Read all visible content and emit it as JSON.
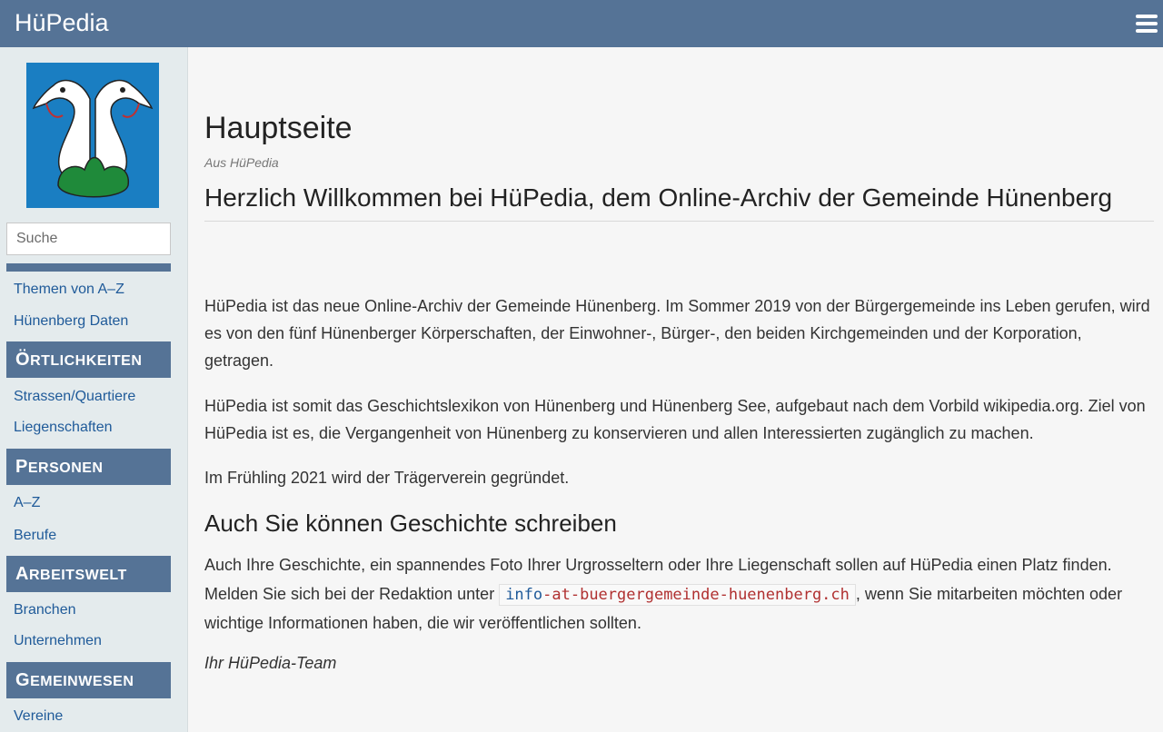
{
  "header": {
    "site_title": "HüPedia"
  },
  "sidebar": {
    "search_placeholder": "Suche",
    "links_top": [
      "Themen von A–Z",
      "Hünenberg Daten"
    ],
    "sections": [
      {
        "cap": "Ö",
        "rest": "RTLICHKEITEN",
        "items": [
          "Strassen/Quartiere",
          "Liegenschaften"
        ]
      },
      {
        "cap": "P",
        "rest": "ERSONEN",
        "items": [
          "A–Z",
          "Berufe"
        ]
      },
      {
        "cap": "A",
        "rest": "RBEITSWELT",
        "items": [
          "Branchen",
          "Unternehmen"
        ]
      },
      {
        "cap": "G",
        "rest": "EMEINWESEN",
        "items": [
          "Vereine"
        ]
      }
    ]
  },
  "main": {
    "title": "Hauptseite",
    "subtitle": "Aus HüPedia",
    "welcome_heading": "Herzlich Willkommen bei HüPedia, dem Online-Archiv der Gemeinde Hünenberg",
    "p1": "HüPedia ist das neue Online-Archiv der Gemeinde Hünenberg. Im Sommer 2019 von der Bürgergemeinde ins Leben gerufen, wird es von den fünf Hünenberger Körperschaften, der Einwohner-, Bürger-, den beiden Kirchgemeinden und der Korporation, getragen.",
    "p2": "HüPedia ist somit das Geschichtslexikon von Hünenberg und Hünenberg See, aufgebaut nach dem Vorbild wikipedia.org. Ziel von HüPedia ist es, die Vergangenheit von Hünenberg zu konservieren und allen Interessierten zugänglich zu machen.",
    "p3": "Im Frühling 2021 wird der Trägerverein gegründet.",
    "h2": "Auch Sie können Geschichte schreiben",
    "p4_before": "Auch Ihre Geschichte, ein spannendes Foto Ihrer Urgrosseltern oder Ihre Liegenschaft sollen auf HüPedia einen Platz finden. Melden Sie sich bei der Redaktion unter ",
    "email_user": "info",
    "email_rest": "-at-buergergemeinde-huenenberg.ch",
    "p4_after": ", wenn Sie mitarbeiten möchten oder wichtige Informationen haben, die wir veröffentlichen sollten.",
    "signature": "Ihr HüPedia-Team"
  },
  "colors": {
    "header": "#557396",
    "sidebar": "#e4ebed",
    "link": "#1f5a99",
    "logo_bg": "#1a7ec2",
    "logo_green": "#1f8a3a"
  }
}
